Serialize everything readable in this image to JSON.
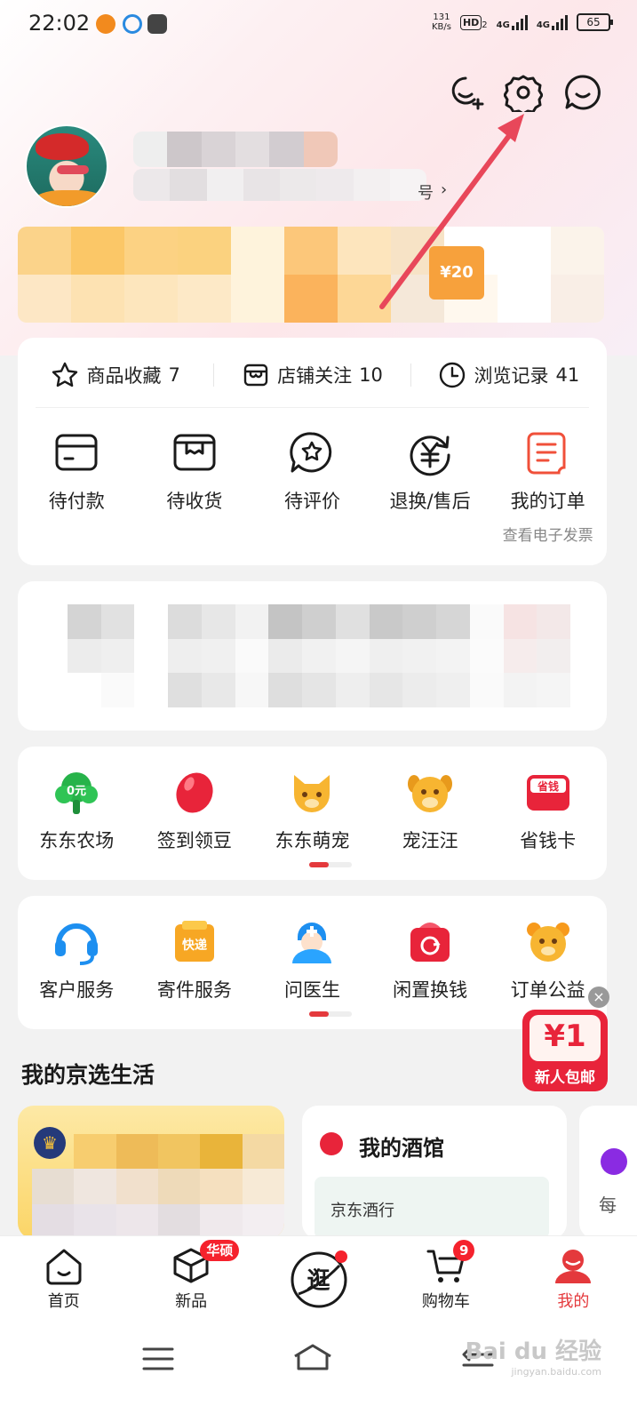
{
  "status_bar": {
    "time": "22:02",
    "net_speed_value": "131",
    "net_speed_unit": "KB/s",
    "hd_label": "HD",
    "hd_sub": "2",
    "signal1": "4G",
    "signal2": "4G",
    "battery": "65"
  },
  "header": {
    "add_friend_icon": "add-user-icon",
    "settings_icon": "gear-icon",
    "message_icon": "message-icon"
  },
  "profile": {
    "account_suffix": "号",
    "coupon_value": "¥20"
  },
  "stats": [
    {
      "label": "商品收藏",
      "count": "7",
      "icon": "star-icon"
    },
    {
      "label": "店铺关注",
      "count": "10",
      "icon": "shop-icon"
    },
    {
      "label": "浏览记录",
      "count": "41",
      "icon": "clock-icon"
    }
  ],
  "orders": [
    {
      "label": "待付款",
      "icon": "wallet-icon"
    },
    {
      "label": "待收货",
      "icon": "package-icon"
    },
    {
      "label": "待评价",
      "icon": "review-icon"
    },
    {
      "label": "退换/售后",
      "icon": "refund-icon"
    },
    {
      "label": "我的订单",
      "icon": "order-list-icon",
      "sub": "查看电子发票"
    }
  ],
  "services1": [
    {
      "label": "东东农场",
      "icon": "farm-icon",
      "icon_text": "0元"
    },
    {
      "label": "签到领豆",
      "icon": "bean-icon"
    },
    {
      "label": "东东萌宠",
      "icon": "cat-icon"
    },
    {
      "label": "宠汪汪",
      "icon": "dog-icon"
    },
    {
      "label": "省钱卡",
      "icon": "savings-card-icon",
      "icon_text": "省钱"
    }
  ],
  "services2": [
    {
      "label": "客户服务",
      "icon": "headset-icon"
    },
    {
      "label": "寄件服务",
      "icon": "express-icon",
      "icon_text": "快递"
    },
    {
      "label": "问医生",
      "icon": "doctor-icon"
    },
    {
      "label": "闲置换钱",
      "icon": "recycle-icon"
    },
    {
      "label": "订单公益",
      "icon": "charity-bear-icon"
    }
  ],
  "section": {
    "title": "我的京选生活",
    "card2_title": "我的酒馆",
    "card2_sub": "京东酒行",
    "card3_text": "每"
  },
  "promo": {
    "price": "¥1",
    "label": "新人包邮"
  },
  "tabbar": [
    {
      "label": "首页",
      "icon": "home-icon"
    },
    {
      "label": "新品",
      "icon": "cube-icon",
      "badge": "华硕"
    },
    {
      "label": "逛",
      "icon": "explore-icon"
    },
    {
      "label": "购物车",
      "icon": "cart-icon",
      "badge": "9"
    },
    {
      "label": "我的",
      "icon": "profile-icon",
      "active": true
    }
  ],
  "watermark": {
    "text": "Bai du 经验",
    "sub": "jingyan.baidu.com"
  },
  "colors": {
    "accent": "#e4393c",
    "annotation_arrow": "#e8475a"
  }
}
